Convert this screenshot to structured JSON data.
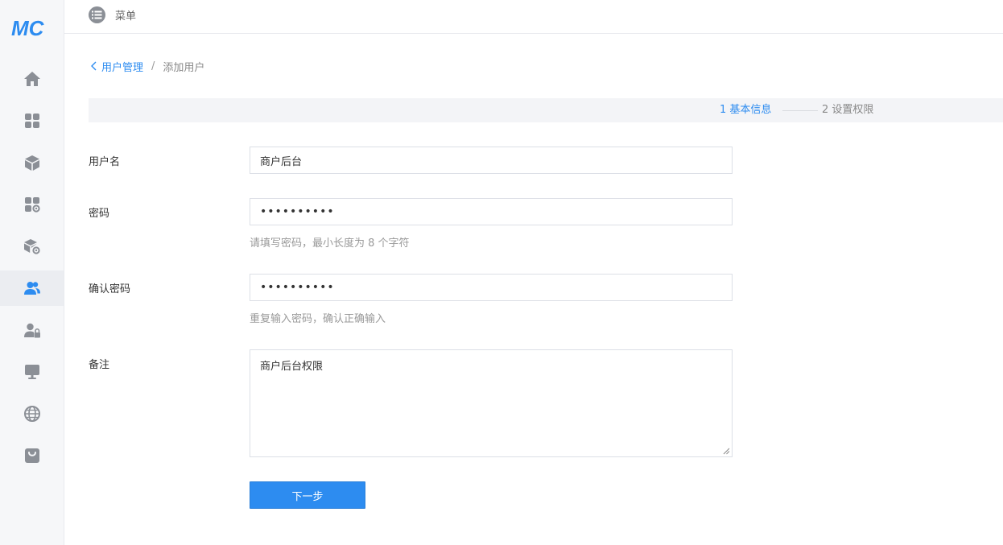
{
  "logo": {
    "text": "MC"
  },
  "topbar": {
    "menu_label": "菜单",
    "menu_icon": "list-icon"
  },
  "sidebar": {
    "items": [
      {
        "icon": "home-icon",
        "active": false
      },
      {
        "icon": "grid-icon",
        "active": false
      },
      {
        "icon": "cube-icon",
        "active": false
      },
      {
        "icon": "grid-settings-icon",
        "active": false
      },
      {
        "icon": "cube-settings-icon",
        "active": false
      },
      {
        "icon": "users-icon",
        "active": true
      },
      {
        "icon": "user-lock-icon",
        "active": false
      },
      {
        "icon": "monitor-icon",
        "active": false
      },
      {
        "icon": "globe-icon",
        "active": false
      },
      {
        "icon": "shopping-bag-icon",
        "active": false
      }
    ]
  },
  "breadcrumb": {
    "parent": "用户管理",
    "separator": "/",
    "current": "添加用户"
  },
  "steps": {
    "step1": "1 基本信息",
    "step2": "2 设置权限"
  },
  "form": {
    "username": {
      "label": "用户名",
      "value": "商户后台"
    },
    "password": {
      "label": "密码",
      "value": "••••••••••",
      "hint": "请填写密码，最小长度为 8 个字符"
    },
    "confirm": {
      "label": "确认密码",
      "value": "••••••••••",
      "hint": "重复输入密码，确认正确输入"
    },
    "remark": {
      "label": "备注",
      "value": "商户后台权限"
    },
    "next_label": "下一步"
  },
  "colors": {
    "accent": "#2d8cf0",
    "sidebar_bg": "#f6f7f9",
    "icon": "#8b8f96"
  }
}
